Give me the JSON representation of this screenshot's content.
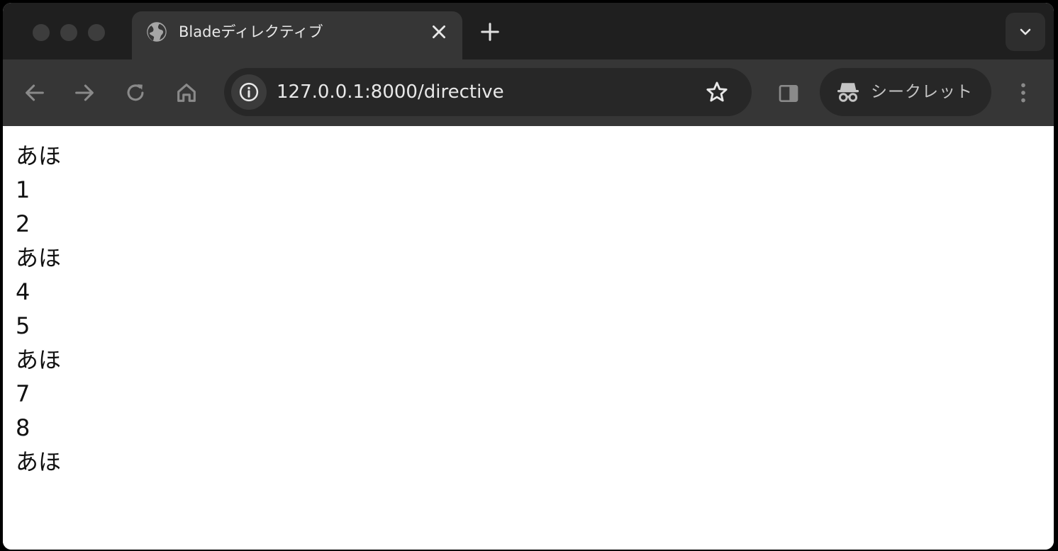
{
  "tab": {
    "title": "Bladeディレクティブ",
    "favicon": "globe-icon",
    "close": "close-icon"
  },
  "toolbar": {
    "url": "127.0.0.1:8000/directive",
    "incognito_label": "シークレット"
  },
  "content": {
    "lines": [
      "あほ",
      "1",
      "2",
      "あほ",
      "4",
      "5",
      "あほ",
      "7",
      "8",
      "あほ"
    ]
  }
}
